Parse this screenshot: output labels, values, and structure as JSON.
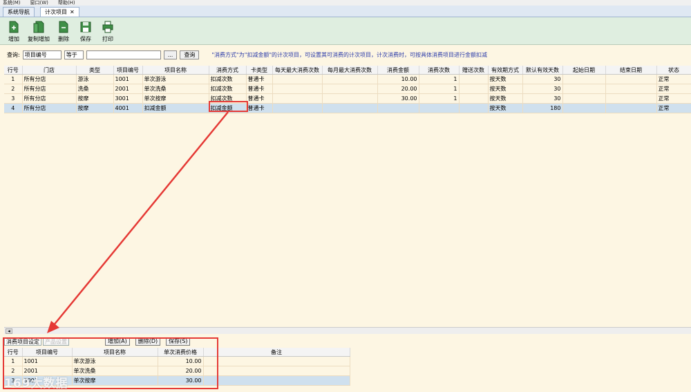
{
  "menubar": [
    "系统(M)",
    "窗口(W)",
    "帮助(H)"
  ],
  "tabs": [
    {
      "label": "系统导航"
    },
    {
      "label": "计次项目",
      "close": "✕"
    }
  ],
  "toolbar": [
    {
      "label": "增加",
      "icon": "add-doc-icon"
    },
    {
      "label": "复制增加",
      "icon": "copy-add-icon"
    },
    {
      "label": "删除",
      "icon": "delete-doc-icon"
    },
    {
      "label": "保存",
      "icon": "save-icon"
    },
    {
      "label": "打印",
      "icon": "print-icon"
    }
  ],
  "query": {
    "label": "查询:",
    "field": "项目编号",
    "operator": "等于",
    "value": "",
    "browse": "...",
    "button": "查询",
    "note": "\"消费方式\"为\"扣减金额\"的计次项目，可设置其可消费的计次项目，计次消费时，可按具体消费项目进行金额扣减"
  },
  "main_table": {
    "columns": [
      "行号",
      "门店",
      "类型",
      "项目编号",
      "项目名称",
      "消费方式",
      "卡类型",
      "每天最大消费次数",
      "每月最大消费次数",
      "消费金额",
      "消费次数",
      "赠送次数",
      "有效期方式",
      "默认有效天数",
      "起始日期",
      "结束日期",
      "状态"
    ],
    "rows": [
      [
        "1",
        "所有分店",
        "游泳",
        "1001",
        "单次游泳",
        "扣减次数",
        "普通卡",
        "",
        "",
        "10.00",
        "1",
        "",
        "按天数",
        "30",
        "",
        "",
        "正常"
      ],
      [
        "2",
        "所有分店",
        "洗桑",
        "2001",
        "单次洗桑",
        "扣减次数",
        "普通卡",
        "",
        "",
        "20.00",
        "1",
        "",
        "按天数",
        "30",
        "",
        "",
        "正常"
      ],
      [
        "3",
        "所有分店",
        "按摩",
        "3001",
        "单次按摩",
        "扣减次数",
        "普通卡",
        "",
        "",
        "30.00",
        "1",
        "",
        "按天数",
        "30",
        "",
        "",
        "正常"
      ],
      [
        "4",
        "所有分店",
        "按摩",
        "4001",
        "扣减金额",
        "扣减金额",
        "普通卡",
        "",
        "",
        "",
        "",
        "",
        "按天数",
        "180",
        "",
        "",
        "正常"
      ]
    ],
    "selected_row": 3
  },
  "scroll_left": "◂",
  "subtabs": [
    {
      "label": "消费项目设定"
    },
    {
      "label": "产品设置"
    }
  ],
  "subbuttons": [
    "增加(A)",
    "删除(D)",
    "保存(S)"
  ],
  "sub_table": {
    "columns": [
      "行号",
      "项目编号",
      "项目名称",
      "单次消费价格",
      "备注"
    ],
    "rows": [
      [
        "1",
        "1001",
        "单次游泳",
        "10.00",
        ""
      ],
      [
        "2",
        "2001",
        "单次洗桑",
        "20.00",
        ""
      ],
      [
        "3",
        "3001",
        "单次按摩",
        "30.00",
        ""
      ]
    ],
    "selected_row": 2
  },
  "watermark": "169大数据",
  "colors": {
    "highlight": "#e53935",
    "selection": "#cfe0ee",
    "grid_bg": "#fdf6e3",
    "toolbar_bg": "#dfeee0",
    "note": "#2a3aa8"
  }
}
